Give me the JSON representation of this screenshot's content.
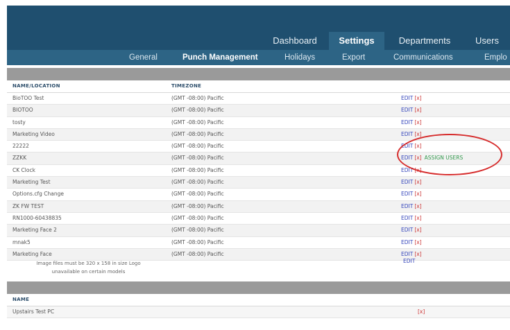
{
  "main_nav": [
    {
      "label": "Dashboard",
      "active": false
    },
    {
      "label": "Settings",
      "active": true
    },
    {
      "label": "Departments",
      "active": false
    },
    {
      "label": "Users",
      "active": false
    }
  ],
  "sub_nav": [
    {
      "label": "General",
      "active": false
    },
    {
      "label": "Punch Management",
      "active": true
    },
    {
      "label": "Holidays",
      "active": false
    },
    {
      "label": "Export",
      "active": false
    },
    {
      "label": "Communications",
      "active": false
    },
    {
      "label": "Emplo",
      "active": false
    }
  ],
  "clocks_table": {
    "headers": {
      "name": "NAME/LOCATION",
      "timezone": "TIMEZONE"
    },
    "rows": [
      {
        "name": "BioTOO Test",
        "timezone": "(GMT -08:00) Pacific",
        "edit": "EDIT",
        "delete": "[x]",
        "assign": ""
      },
      {
        "name": "BIOTOO",
        "timezone": "(GMT -08:00) Pacific",
        "edit": "EDIT",
        "delete": "[x]",
        "assign": ""
      },
      {
        "name": "tosty",
        "timezone": "(GMT -08:00) Pacific",
        "edit": "EDIT",
        "delete": "[x]",
        "assign": ""
      },
      {
        "name": "Marketing Video",
        "timezone": "(GMT -08:00) Pacific",
        "edit": "EDIT",
        "delete": "[x]",
        "assign": ""
      },
      {
        "name": "22222",
        "timezone": "(GMT -08:00) Pacific",
        "edit": "EDIT",
        "delete": "[x]",
        "assign": ""
      },
      {
        "name": "ZZKK",
        "timezone": "(GMT -08:00) Pacific",
        "edit": "EDIT",
        "delete": "[x]",
        "assign": "ASSIGN USERS"
      },
      {
        "name": "CK Clock",
        "timezone": "(GMT -08:00) Pacific",
        "edit": "EDIT",
        "delete": "[x]",
        "assign": ""
      },
      {
        "name": "Marketing Test",
        "timezone": "(GMT -08:00) Pacific",
        "edit": "EDIT",
        "delete": "[x]",
        "assign": ""
      },
      {
        "name": "Options.cfg Change",
        "timezone": "(GMT -08:00) Pacific",
        "edit": "EDIT",
        "delete": "[x]",
        "assign": ""
      },
      {
        "name": "ZK FW TEST",
        "timezone": "(GMT -08:00) Pacific",
        "edit": "EDIT",
        "delete": "[x]",
        "assign": ""
      },
      {
        "name": "RN1000-60438835",
        "timezone": "(GMT -08:00) Pacific",
        "edit": "EDIT",
        "delete": "[x]",
        "assign": ""
      },
      {
        "name": "Marketing Face 2",
        "timezone": "(GMT -08:00) Pacific",
        "edit": "EDIT",
        "delete": "[x]",
        "assign": ""
      },
      {
        "name": "mnak5",
        "timezone": "(GMT -08:00) Pacific",
        "edit": "EDIT",
        "delete": "[x]",
        "assign": ""
      },
      {
        "name": "Marketing Face",
        "timezone": "(GMT -08:00) Pacific",
        "edit": "EDIT",
        "delete": "[x]",
        "assign": ""
      }
    ]
  },
  "logo_note": {
    "line1": "Image files must be 320 x 158 in size Logo",
    "line2": "unavailable on certain models",
    "edit": "EDIT"
  },
  "pc_table": {
    "headers": {
      "name": "NAME"
    },
    "rows": [
      {
        "name": "Upstairs Test PC",
        "delete": "[x]"
      }
    ]
  },
  "colors": {
    "topbar": "#1f4f6f",
    "subbar": "#2d6485",
    "highlight_circle": "#d62b2b"
  }
}
